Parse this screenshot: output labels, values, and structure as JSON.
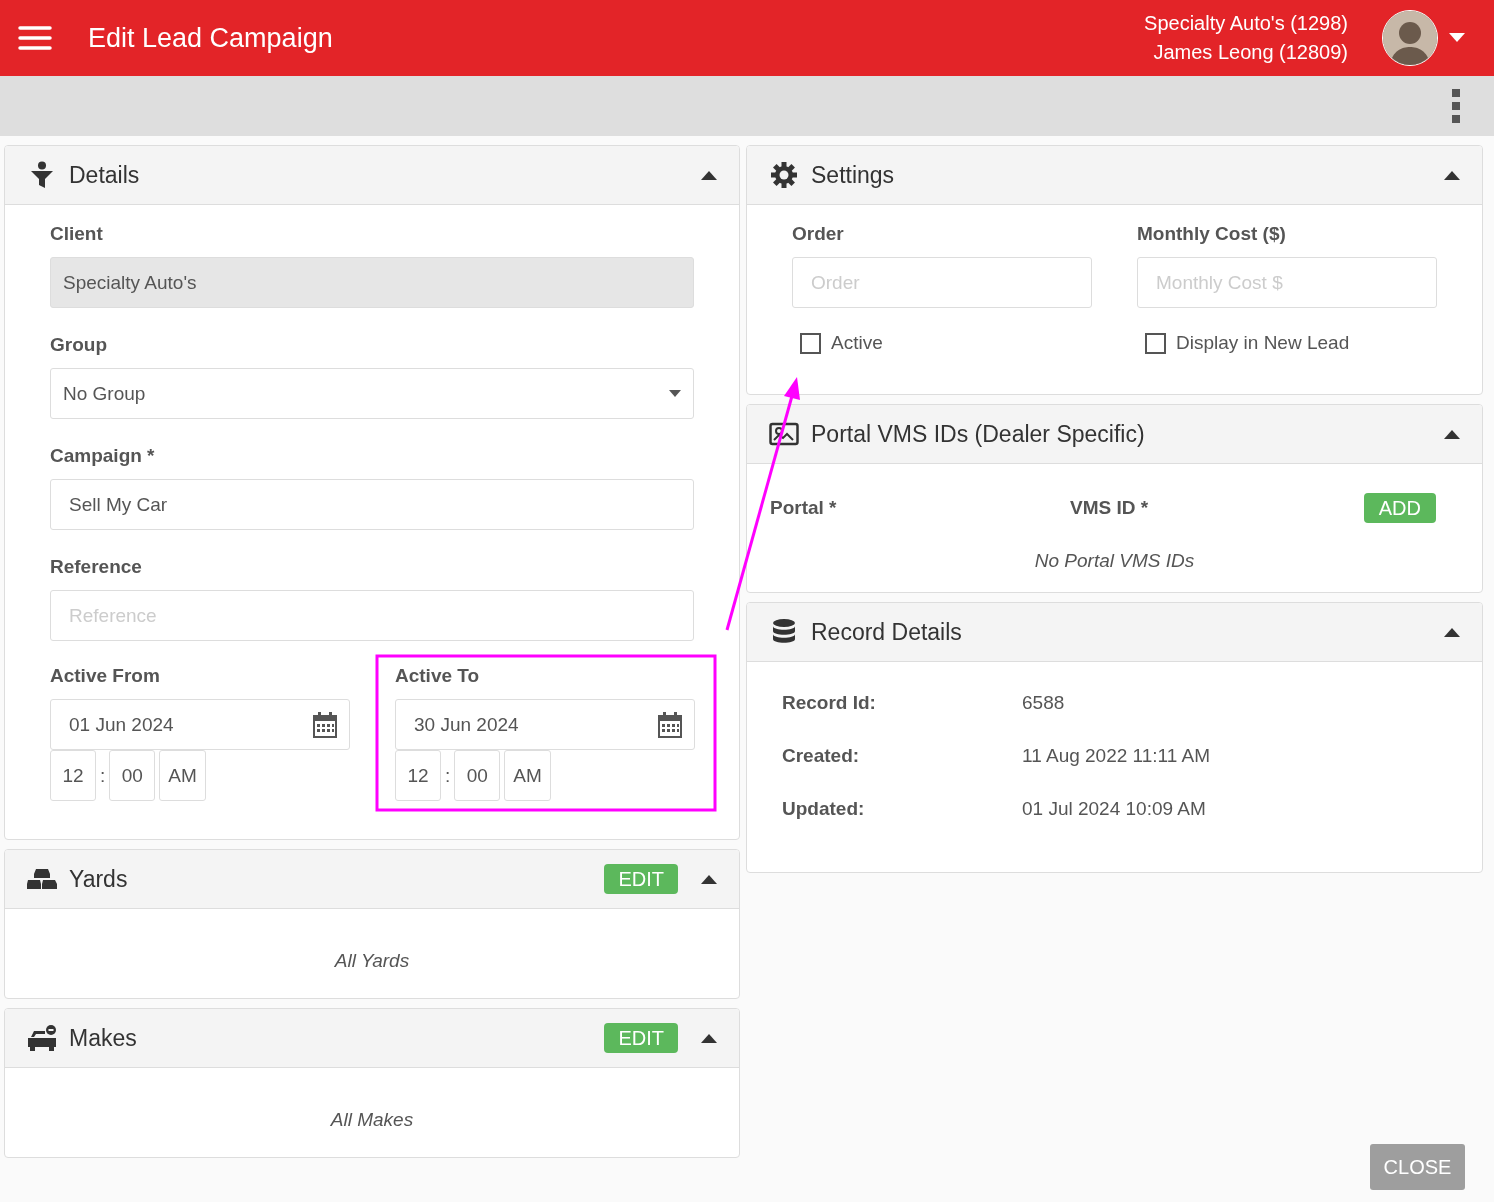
{
  "header": {
    "title": "Edit Lead Campaign",
    "account_lines": [
      "Specialty Auto's (1298)",
      "James Leong (12809)"
    ]
  },
  "details": {
    "title": "Details",
    "expanded": true,
    "fields": [
      {
        "kind": "readonly",
        "label": "Client",
        "value": "Specialty Auto's"
      },
      {
        "kind": "select",
        "label": "Group",
        "value": "No Group"
      },
      {
        "kind": "text",
        "label": "Campaign *",
        "value": "Sell My Car"
      },
      {
        "kind": "text",
        "label": "Reference",
        "placeholder": "Reference"
      }
    ],
    "dates": [
      {
        "label": "Active From",
        "date": "01 Jun 2024",
        "hour": "12",
        "separator": ":",
        "minute": "00",
        "period": "AM"
      },
      {
        "label": "Active To",
        "date": "30 Jun 2024",
        "hour": "12",
        "separator": ":",
        "minute": "00",
        "period": "AM"
      }
    ]
  },
  "yards": {
    "title": "Yards",
    "edit_button": "EDIT",
    "expanded": true,
    "empty_text": "All Yards"
  },
  "makes": {
    "title": "Makes",
    "edit_button": "EDIT",
    "expanded": true,
    "empty_text": "All Makes"
  },
  "settings": {
    "title": "Settings",
    "expanded": true,
    "fields": [
      {
        "label": "Order",
        "placeholder": "Order"
      },
      {
        "label": "Monthly Cost ($)",
        "placeholder": "Monthly Cost $"
      }
    ],
    "checkboxes": [
      {
        "label": "Active",
        "checked": false
      },
      {
        "label": "Display in New Lead",
        "checked": false
      }
    ]
  },
  "portal_vms": {
    "title": "Portal VMS IDs (Dealer Specific)",
    "expanded": true,
    "columns": [
      "Portal *",
      "VMS ID *"
    ],
    "add_button": "ADD",
    "empty_text": "No Portal VMS IDs"
  },
  "record_details": {
    "title": "Record Details",
    "expanded": true,
    "rows": [
      {
        "label": "Record Id:",
        "value": "6588"
      },
      {
        "label": "Created:",
        "value": "11 Aug 2022 11:11 AM"
      },
      {
        "label": "Updated:",
        "value": "01 Jul 2024 10:09 AM"
      }
    ]
  },
  "close_button": "CLOSE"
}
